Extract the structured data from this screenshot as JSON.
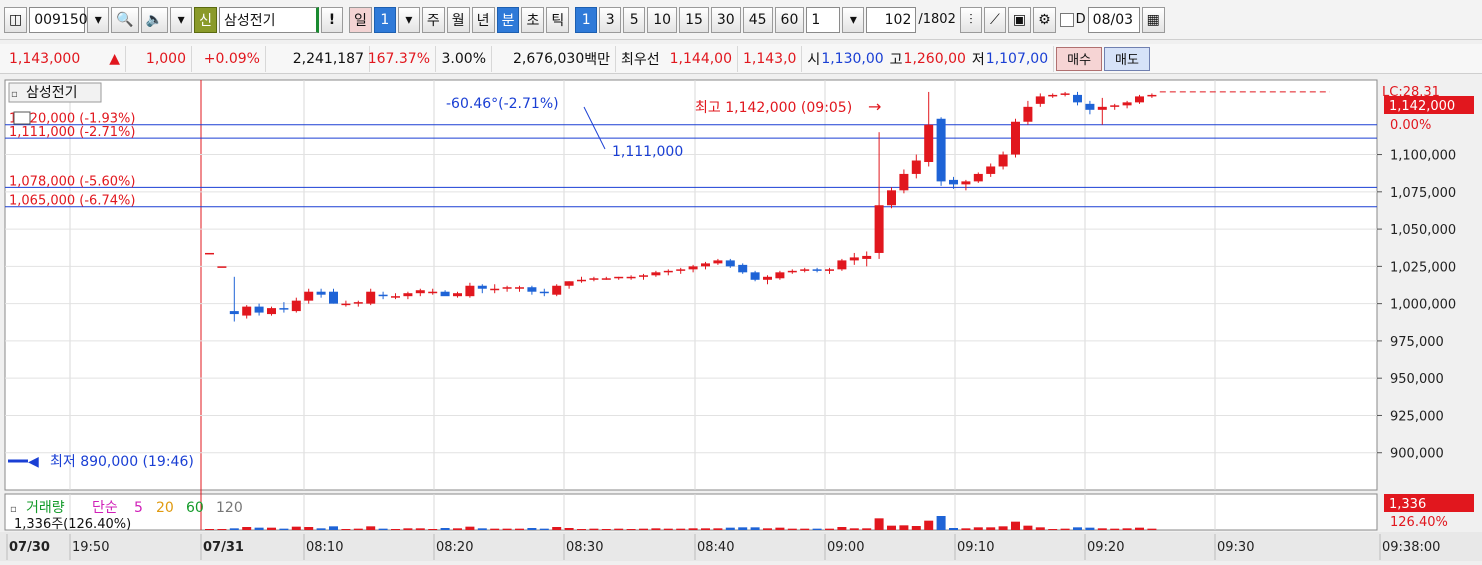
{
  "toolbar": {
    "code": "009150",
    "stock_name": "삼성전기",
    "badge_new": "신",
    "alert_label": "!",
    "day_label": "일",
    "day_value": "1",
    "week": "주",
    "month": "월",
    "year": "년",
    "minute": "분",
    "second": "초",
    "tick": "틱",
    "intervals": [
      "1",
      "3",
      "5",
      "10",
      "15",
      "30",
      "45",
      "60"
    ],
    "active_interval": "1",
    "multiplier": "1",
    "count": "102",
    "total": "/1802",
    "d_label": "D",
    "date": "08/03"
  },
  "quote": {
    "price": "1,143,000",
    "arrow": "▲",
    "change": "1,000",
    "change_pct": "+0.09%",
    "volume": "2,241,187",
    "volume_ratio": "167.37%",
    "turnover_pct": "3.00%",
    "amount": "2,676,030",
    "amount_unit": "백만",
    "best_label": "최우선",
    "ask": "1,144,00",
    "bid": "1,143,0",
    "open_label": "시",
    "open": "1,130,00",
    "high_label": "고",
    "high": "1,260,00",
    "low_label": "저",
    "low": "1,107,00",
    "buy_label": "매수",
    "sell_label": "매도"
  },
  "chart_data": {
    "type": "candlestick",
    "title": "삼성전기",
    "ylim": [
      875000,
      1150000
    ],
    "y_ticks": [
      "1,100,000",
      "1,075,000",
      "1,050,000",
      "1,025,000",
      "1,000,000",
      "975,000",
      "950,000",
      "925,000",
      "900,000"
    ],
    "y_tick_values": [
      1100000,
      1075000,
      1050000,
      1025000,
      1000000,
      975000,
      950000,
      925000,
      900000
    ],
    "x_ticks": [
      "07/30",
      "19:50",
      "07/31",
      "08:10",
      "08:20",
      "08:30",
      "08:40",
      "09:00",
      "09:10",
      "09:20",
      "09:30",
      "09:38:00"
    ],
    "last_price_label": "1,142,000",
    "last_price": 1142000,
    "lc_label": "LC:28.31",
    "pct_label": "0.00%",
    "high_annotation": "최고 1,142,000 (09:05)",
    "low_annotation": "최저 890,000 (19:46)",
    "trendline_label": "-60.46°(-2.71%)",
    "trendline_price": "1,111,000",
    "hlines": [
      {
        "label": "1,120,000 (-1.93%)",
        "price": 1120000
      },
      {
        "label": "1,111,000 (-2.71%)",
        "price": 1111000
      },
      {
        "label": "1,078,000 (-5.60%)",
        "price": 1078000
      },
      {
        "label": "1,065,000 (-6.74%)",
        "price": 1065000
      }
    ],
    "candles": [
      [
        1034000,
        1034000,
        1034000,
        1034000
      ],
      [
        1025000,
        1025000,
        1025000,
        1025000
      ],
      [
        995000,
        1018000,
        988000,
        993000
      ],
      [
        992000,
        999000,
        990000,
        998000
      ],
      [
        998000,
        1000000,
        992000,
        994000
      ],
      [
        993000,
        998000,
        992000,
        997000
      ],
      [
        997000,
        1001000,
        994000,
        996000
      ],
      [
        995000,
        1004000,
        994000,
        1002000
      ],
      [
        1002000,
        1010000,
        1000000,
        1008000
      ],
      [
        1008000,
        1010000,
        1004000,
        1006000
      ],
      [
        1008000,
        1010000,
        1000000,
        1000000
      ],
      [
        1000000,
        1002000,
        998000,
        1000000
      ],
      [
        1000000,
        1002000,
        998000,
        1001000
      ],
      [
        1000000,
        1010000,
        999000,
        1008000
      ],
      [
        1006000,
        1008000,
        1003000,
        1005000
      ],
      [
        1005000,
        1007000,
        1003000,
        1005000
      ],
      [
        1005000,
        1008000,
        1003000,
        1007000
      ],
      [
        1007000,
        1010000,
        1005000,
        1009000
      ],
      [
        1008000,
        1010000,
        1006000,
        1008000
      ],
      [
        1008000,
        1009000,
        1006000,
        1005000
      ],
      [
        1005000,
        1008000,
        1004000,
        1007000
      ],
      [
        1005000,
        1014000,
        1004000,
        1012000
      ],
      [
        1012000,
        1013000,
        1007000,
        1010000
      ],
      [
        1009000,
        1013000,
        1007000,
        1010000
      ],
      [
        1010000,
        1012000,
        1008000,
        1011000
      ],
      [
        1010000,
        1012000,
        1008000,
        1011000
      ],
      [
        1011000,
        1012000,
        1006000,
        1008000
      ],
      [
        1008000,
        1010000,
        1005000,
        1007000
      ],
      [
        1006000,
        1013000,
        1005000,
        1012000
      ],
      [
        1012000,
        1015000,
        1010000,
        1015000
      ],
      [
        1016000,
        1018000,
        1014000,
        1016000
      ],
      [
        1016000,
        1018000,
        1015000,
        1017000
      ],
      [
        1017000,
        1018000,
        1016000,
        1017000
      ],
      [
        1017000,
        1018000,
        1016000,
        1018000
      ],
      [
        1018000,
        1019000,
        1016000,
        1018000
      ],
      [
        1018000,
        1020000,
        1016000,
        1019000
      ],
      [
        1019000,
        1022000,
        1018000,
        1021000
      ],
      [
        1021000,
        1023000,
        1019000,
        1022000
      ],
      [
        1022000,
        1024000,
        1020000,
        1023000
      ],
      [
        1023000,
        1026000,
        1021000,
        1025000
      ],
      [
        1025000,
        1028000,
        1023000,
        1027000
      ],
      [
        1027000,
        1030000,
        1026000,
        1029000
      ],
      [
        1029000,
        1030000,
        1024000,
        1025000
      ],
      [
        1026000,
        1027000,
        1020000,
        1021000
      ],
      [
        1021000,
        1022000,
        1015000,
        1016000
      ],
      [
        1016000,
        1019000,
        1013000,
        1018000
      ],
      [
        1017000,
        1022000,
        1016000,
        1021000
      ],
      [
        1021000,
        1023000,
        1020000,
        1022000
      ],
      [
        1022000,
        1024000,
        1021000,
        1023000
      ],
      [
        1023000,
        1024000,
        1021000,
        1022000
      ],
      [
        1022000,
        1024000,
        1020000,
        1023000
      ],
      [
        1023000,
        1030000,
        1022000,
        1029000
      ],
      [
        1029000,
        1034000,
        1026000,
        1031000
      ],
      [
        1030000,
        1035000,
        1025000,
        1032000
      ],
      [
        1034000,
        1115000,
        1030000,
        1066000
      ],
      [
        1066000,
        1078000,
        1064000,
        1076000
      ],
      [
        1076000,
        1090000,
        1074000,
        1087000
      ],
      [
        1087000,
        1100000,
        1084000,
        1096000
      ],
      [
        1095000,
        1142000,
        1092000,
        1120000
      ],
      [
        1124000,
        1125000,
        1079000,
        1082000
      ],
      [
        1083000,
        1085000,
        1077000,
        1080000
      ],
      [
        1080000,
        1083000,
        1076000,
        1082000
      ],
      [
        1082000,
        1088000,
        1081000,
        1087000
      ],
      [
        1087000,
        1094000,
        1085000,
        1092000
      ],
      [
        1092000,
        1102000,
        1090000,
        1100000
      ],
      [
        1100000,
        1124000,
        1098000,
        1122000
      ],
      [
        1122000,
        1136000,
        1120000,
        1132000
      ],
      [
        1134000,
        1141000,
        1132000,
        1139000
      ],
      [
        1140000,
        1141000,
        1138000,
        1140000
      ],
      [
        1140000,
        1142000,
        1139000,
        1141000
      ],
      [
        1140000,
        1142000,
        1133000,
        1135000
      ],
      [
        1134000,
        1136000,
        1127000,
        1130000
      ],
      [
        1130000,
        1138000,
        1120000,
        1132000
      ],
      [
        1132000,
        1134000,
        1130000,
        1133000
      ],
      [
        1133000,
        1136000,
        1131000,
        1135000
      ],
      [
        1135000,
        1140000,
        1134000,
        1139000
      ],
      [
        1139000,
        1141000,
        1138000,
        1140000
      ]
    ],
    "volume_legend": {
      "label": "거래량",
      "ma_label": "단순",
      "ma1": "5",
      "ma2": "20",
      "ma3": "60",
      "ma4": "120"
    },
    "volume_text": "1,336주(126.40%)",
    "volume_last": "1,336",
    "volume_pct": "126.40%"
  }
}
